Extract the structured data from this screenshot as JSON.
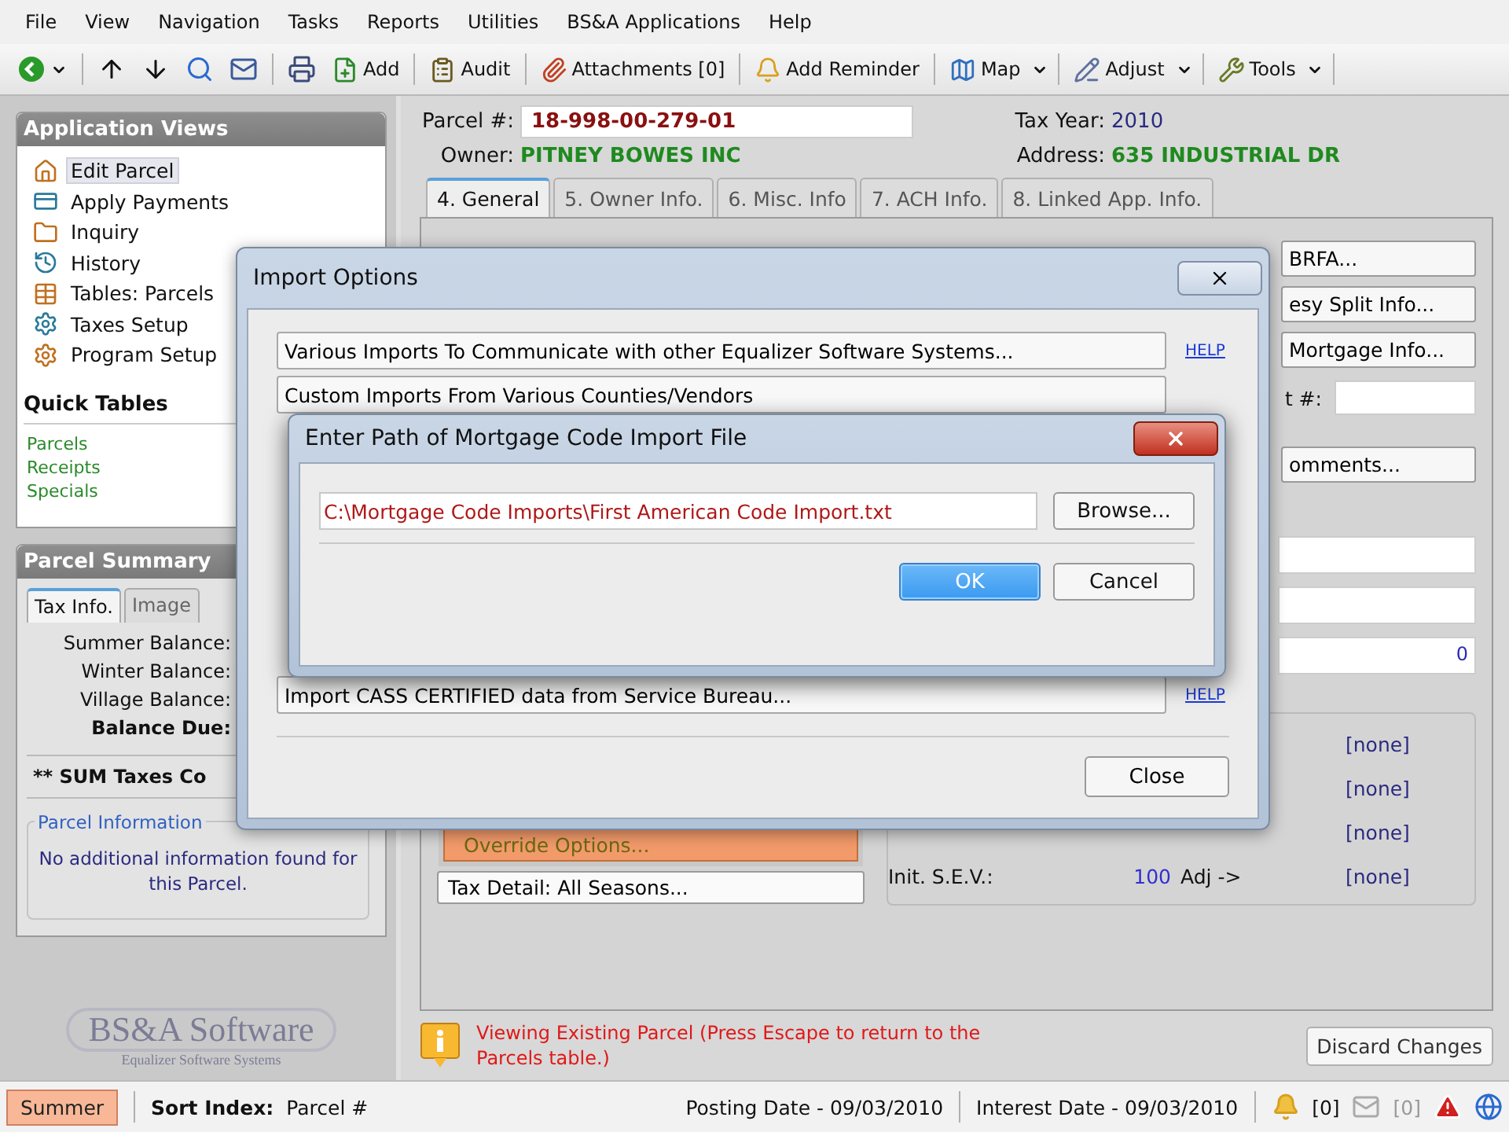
{
  "menu": [
    "File",
    "View",
    "Navigation",
    "Tasks",
    "Reports",
    "Utilities",
    "BS&A Applications",
    "Help"
  ],
  "toolbar": [
    {
      "label": "Add",
      "dropdown": false
    },
    {
      "label": "Audit",
      "dropdown": false
    },
    {
      "label": "Attachments [0]",
      "dropdown": false
    },
    {
      "label": "Add Reminder",
      "dropdown": false
    },
    {
      "label": "Map",
      "dropdown": true
    },
    {
      "label": "Adjust",
      "dropdown": true
    },
    {
      "label": "Tools",
      "dropdown": true
    }
  ],
  "application_views": {
    "title": "Application Views",
    "items": [
      {
        "label": "Edit Parcel",
        "selected": true
      },
      {
        "label": "Apply Payments",
        "selected": false
      },
      {
        "label": "Inquiry",
        "selected": false
      },
      {
        "label": "History",
        "selected": false
      },
      {
        "label": "Tables: Parcels",
        "selected": false
      },
      {
        "label": "Taxes Setup",
        "selected": false
      },
      {
        "label": "Program Setup",
        "selected": false
      }
    ]
  },
  "quick_tables": {
    "title": "Quick Tables",
    "links": [
      "Parcels",
      "Receipts",
      "Specials"
    ]
  },
  "parcel_summary": {
    "title": "Parcel Summary",
    "tabs": [
      {
        "label": "Tax Info.",
        "selected": true
      },
      {
        "label": "Image",
        "selected": false
      }
    ],
    "balances": [
      {
        "label": "Summer Balance:",
        "bold": false
      },
      {
        "label": "Winter Balance:",
        "bold": false
      },
      {
        "label": "Village Balance:",
        "bold": false
      },
      {
        "label": "Balance Due:",
        "bold": true
      }
    ],
    "sum_taxes": "** SUM Taxes Co",
    "info_title": "Parcel Information",
    "info_text": "No additional information found for this Parcel."
  },
  "logo": {
    "name": "BS&A Software",
    "tagline": "Equalizer Software Systems"
  },
  "parcel": {
    "number_label": "Parcel #:",
    "number": "18-998-00-279-01",
    "tax_year_label": "Tax Year:",
    "tax_year": "2010",
    "owner_label": "Owner:",
    "owner": "PITNEY BOWES INC",
    "address_label": "Address:",
    "address": "635 INDUSTRIAL DR"
  },
  "tabs": [
    {
      "label": "4. General",
      "selected": true
    },
    {
      "label": "5. Owner Info.",
      "selected": false
    },
    {
      "label": "6. Misc. Info",
      "selected": false
    },
    {
      "label": "7. ACH Info.",
      "selected": false
    },
    {
      "label": "8. Linked App. Info.",
      "selected": false
    }
  ],
  "general": {
    "side_buttons": [
      "BRFA...",
      "esy Split Info...",
      "Mortgage Info..."
    ],
    "field_label": "t #:",
    "comments_button": "omments...",
    "value_fields": [
      "0"
    ],
    "adjustments": [
      "[none]",
      "[none]",
      "[none]",
      "[none]"
    ],
    "sev_label": "Init. S.E.V.:",
    "sev_value": "100",
    "adj_label": "Adj ->",
    "override_button": "Override Options...",
    "tax_detail_button": "Tax Detail: All Seasons..."
  },
  "message": {
    "text": "Viewing Existing Parcel (Press Escape to return to the Parcels table.)",
    "discard_button": "Discard Changes"
  },
  "import_dialog": {
    "title": "Import Options",
    "options": [
      {
        "label": "Various Imports To Communicate with other Equalizer Software Systems...",
        "help": "HELP"
      },
      {
        "label": "Custom Imports From Various Counties/Vendors"
      },
      {
        "label": "Import CASS CERTIFIED data from Service Bureau...",
        "help": "HELP"
      }
    ],
    "close_button": "Close"
  },
  "path_dialog": {
    "title": "Enter Path of Mortgage Code Import File",
    "value": "C:\\Mortgage Code Imports\\First American Code Import.txt",
    "browse_button": "Browse...",
    "buttons": [
      {
        "label": "OK",
        "selected": true
      },
      {
        "label": "Cancel",
        "selected": false
      }
    ]
  },
  "status": {
    "season_button": "Summer",
    "sort_label": "Sort Index:",
    "sort_value": "Parcel #",
    "posting": "Posting Date - 09/03/2010",
    "interest": "Interest Date - 09/03/2010",
    "reminders": "[0]",
    "messages": "[0]"
  }
}
